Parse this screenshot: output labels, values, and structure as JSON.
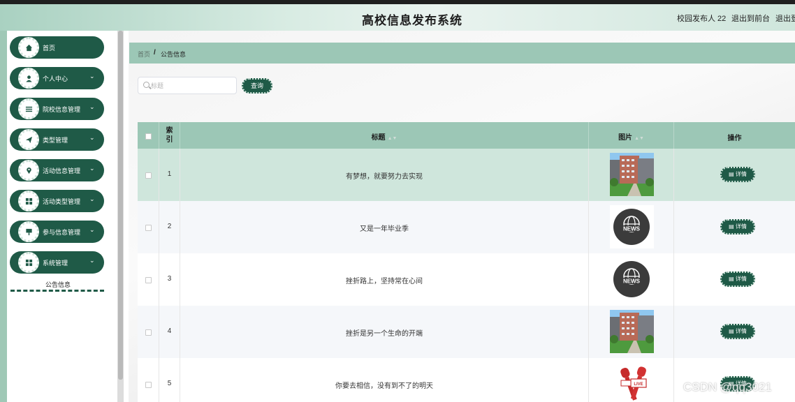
{
  "header": {
    "title": "高校信息发布系统",
    "user_label": "校园发布人 22",
    "front_link": "退出到前台",
    "logout_link": "退出登"
  },
  "sidebar": {
    "items": [
      {
        "label": "首页",
        "icon": "home-icon",
        "has_chevron": false
      },
      {
        "label": "个人中心",
        "icon": "user-icon",
        "has_chevron": true
      },
      {
        "label": "院校信息管理",
        "icon": "list-icon",
        "has_chevron": true
      },
      {
        "label": "类型管理",
        "icon": "send-icon",
        "has_chevron": true
      },
      {
        "label": "活动信息管理",
        "icon": "location-icon",
        "has_chevron": true
      },
      {
        "label": "活动类型管理",
        "icon": "grid-icon",
        "has_chevron": true
      },
      {
        "label": "参与信息管理",
        "icon": "board-icon",
        "has_chevron": true
      },
      {
        "label": "系统管理",
        "icon": "grid-icon",
        "has_chevron": true
      }
    ],
    "sub_item": "公告信息"
  },
  "breadcrumb": {
    "home": "首页",
    "separator": "/",
    "current": "公告信息"
  },
  "search": {
    "placeholder": "标题",
    "button": "查询"
  },
  "table": {
    "headers": {
      "index": "索\n引",
      "title": "标题",
      "image": "图片",
      "actions": "操作"
    },
    "rows": [
      {
        "index": "1",
        "title": "有梦想，就要努力去实现",
        "image": "campus-photo",
        "action": "详情"
      },
      {
        "index": "2",
        "title": "又是一年毕业季",
        "image": "news-globe",
        "action": "详情"
      },
      {
        "index": "3",
        "title": "挫折路上，坚持常在心间",
        "image": "news-globe",
        "action": "详情"
      },
      {
        "index": "4",
        "title": "挫折是另一个生命的开端",
        "image": "campus-photo",
        "action": "详情"
      },
      {
        "index": "5",
        "title": "你要去相信，没有到不了的明天",
        "image": "live-mic",
        "action": "详情"
      }
    ]
  },
  "watermark": "CSDN @qq3021",
  "colors": {
    "accent": "#1f5a47",
    "header_bg": "#9cc7b6",
    "row_highlight": "#cfe6dc",
    "row_alt": "#f5f7fa"
  }
}
